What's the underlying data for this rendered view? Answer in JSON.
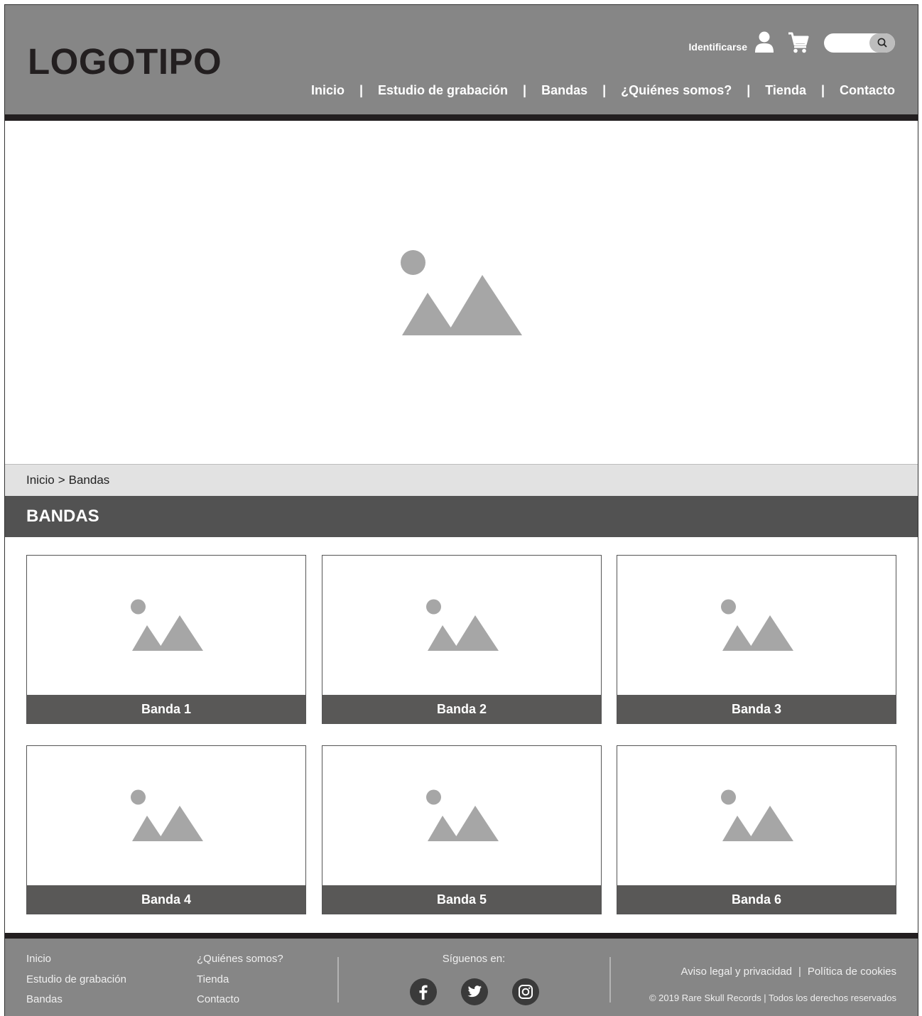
{
  "header": {
    "logo": "LOGOTIPO",
    "login_label": "Identificarse",
    "search_placeholder": "",
    "nav": [
      "Inicio",
      "Estudio de grabación",
      "Bandas",
      "¿Quiénes somos?",
      "Tienda",
      "Contacto"
    ],
    "nav_separator": "|"
  },
  "breadcrumb": {
    "home": "Inicio",
    "separator": ">",
    "current": "Bandas"
  },
  "section": {
    "title": "BANDAS"
  },
  "bands": [
    "Banda 1",
    "Banda 2",
    "Banda 3",
    "Banda 4",
    "Banda 5",
    "Banda 6"
  ],
  "footer": {
    "col1": [
      "Inicio",
      "Estudio de grabación",
      "Bandas"
    ],
    "col2": [
      "¿Quiénes somos?",
      "Tienda",
      "Contacto"
    ],
    "follow_label": "Síguenos en:",
    "social": [
      "facebook-icon",
      "twitter-icon",
      "instagram-icon"
    ],
    "legal_link": "Aviso legal y privacidad",
    "legal_separator": "|",
    "cookies_link": "Política de cookies",
    "copyright": "© 2019 Rare Skull Records | Todos los derechos reservados"
  },
  "colors": {
    "header_bg": "#868686",
    "dark_bar": "#231f20",
    "section_bg": "#525252",
    "caption_bg": "#595857",
    "placeholder": "#a6a6a6"
  }
}
